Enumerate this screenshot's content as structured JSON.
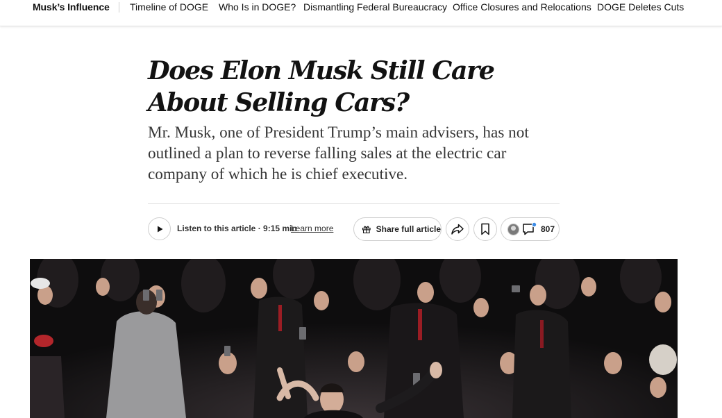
{
  "nav": {
    "brand": "Musk’s Influence",
    "links": [
      "Timeline of  DOGE",
      "Who Is in DOGE?",
      "Dismantling Federal Bureaucracy",
      "Office Closures and Relocations",
      "DOGE Deletes Cuts"
    ]
  },
  "article": {
    "headline": "Does Elon Musk Still Care About Selling Cars?",
    "summary": "Mr. Musk, one of President Trump’s main advisers, has not outlined a plan to reverse falling sales at the electric car company of which he is chief executive."
  },
  "actions": {
    "listen_label": "Listen to this article · 9:15 min",
    "learn_more": "Learn more",
    "share_label": "Share full article",
    "comment_count": "807"
  },
  "icons": {
    "play": "play-icon",
    "gift": "gift-icon",
    "share": "share-arrow-icon",
    "bookmark": "bookmark-icon",
    "comment": "comment-icon"
  },
  "colors": {
    "text": "#121212",
    "summary_text": "#363636",
    "border": "#cfcfcf",
    "comment_dot": "#3c8ce7"
  }
}
